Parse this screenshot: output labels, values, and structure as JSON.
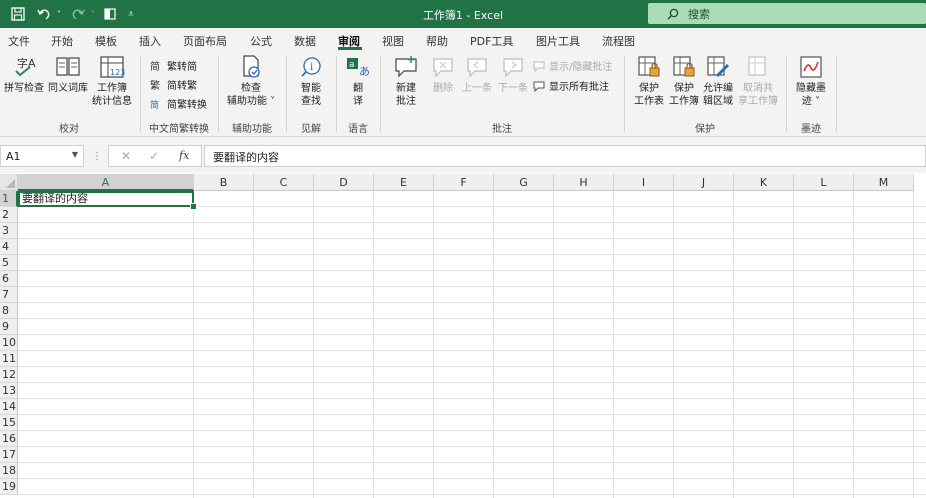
{
  "app": {
    "title": "工作簿1 - Excel",
    "search_placeholder": "搜索",
    "brand_color": "#217346"
  },
  "quick_access": {
    "save_icon": "save-icon",
    "undo_icon": "undo-icon",
    "redo_icon": "redo-icon",
    "touch_icon": "touch-mode-icon",
    "customize_icon": "customize-qat-icon"
  },
  "tabs": [
    "文件",
    "开始",
    "模板",
    "插入",
    "页面布局",
    "公式",
    "数据",
    "审阅",
    "视图",
    "帮助",
    "PDF工具",
    "图片工具",
    "流程图"
  ],
  "active_tab": "审阅",
  "ribbon": {
    "proofing": {
      "label": "校对",
      "spelling": "拼写检查",
      "thesaurus": "同义词库",
      "stats_line1": "工作簿",
      "stats_line2": "统计信息"
    },
    "chinese": {
      "label": "中文简繁转换",
      "trad_to_simp": "繁转简",
      "simp_to_trad": "简转繁",
      "convert": "简繁转换"
    },
    "accessibility": {
      "label": "辅助功能",
      "line1": "检查",
      "line2": "辅助功能 ˅"
    },
    "insights": {
      "label": "见解",
      "line1": "智能",
      "line2": "查找"
    },
    "language": {
      "label": "语言",
      "line1": "翻",
      "line2": "译"
    },
    "comments": {
      "label": "批注",
      "new_line1": "新建",
      "new_line2": "批注",
      "delete": "删除",
      "prev": "上一条",
      "next": "下一条",
      "show_hide": "显示/隐藏批注",
      "show_all": "显示所有批注"
    },
    "protect": {
      "label": "保护",
      "sheet_line1": "保护",
      "sheet_line2": "工作表",
      "wb_line1": "保护",
      "wb_line2": "工作簿",
      "range_line1": "允许编",
      "range_line2": "辑区域",
      "unshare_line1": "取消共",
      "unshare_line2": "享工作簿"
    },
    "ink": {
      "label": "墨迹",
      "line1": "隐藏墨",
      "line2": "迹 ˅"
    }
  },
  "formula_bar": {
    "name_box": "A1",
    "fx": "fx",
    "content": "要翻译的内容"
  },
  "sheet": {
    "columns": [
      "A",
      "B",
      "C",
      "D",
      "E",
      "F",
      "G",
      "H",
      "I",
      "J",
      "K",
      "L",
      "M"
    ],
    "rows": [
      "1",
      "2",
      "3",
      "4",
      "5",
      "6",
      "7",
      "8",
      "9",
      "10",
      "11",
      "12",
      "13",
      "14",
      "15",
      "16",
      "17",
      "18",
      "19"
    ],
    "A1": "要翻译的内容"
  }
}
